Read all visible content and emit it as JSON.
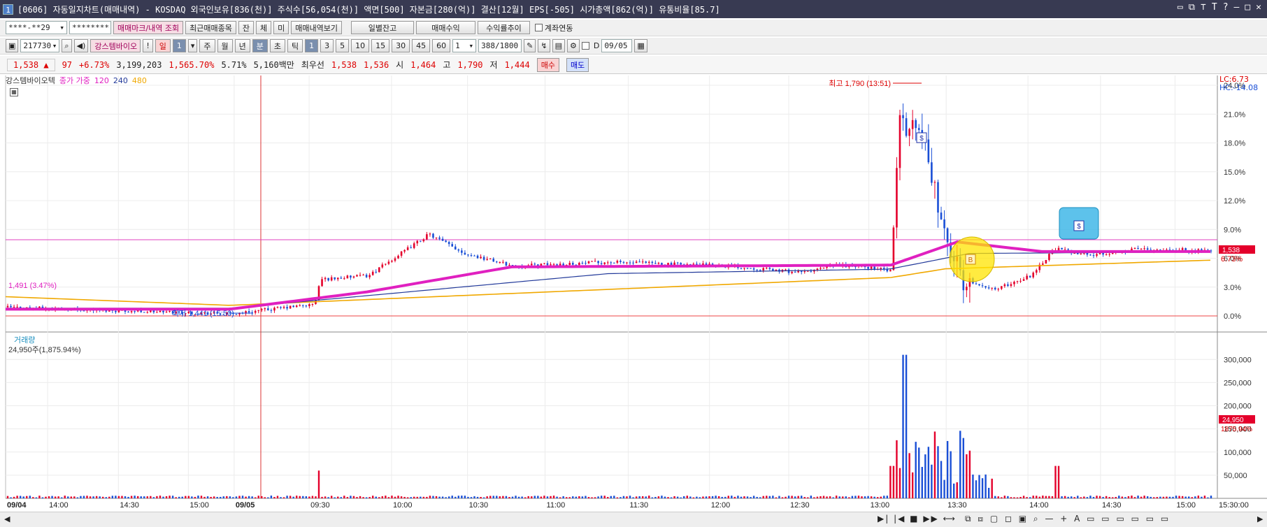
{
  "title": {
    "num": "1",
    "text": "[0606] 자동일지차트(매매내역) - KOSDAQ 외국인보유[836(천)] 주식수[56,054(천)] 액면[500] 자본금[280(억)] 결산[12월] EPS[-505] 시가총액[862(억)] 유통비율[85.7]"
  },
  "toolbar1": {
    "account": "****-**29",
    "password": "********",
    "btn1": "매매마크/내역 조회",
    "btn2": "최근매매종목",
    "btn3": "잔",
    "btn4": "체",
    "btn5": "미",
    "btn6": "매매내역보기",
    "btn7": "일별잔고",
    "btn8": "매매수익",
    "btn9": "수익률추이",
    "check": "계좌연동"
  },
  "toolbar2": {
    "code": "217730",
    "stock": "강스템바이오",
    "periods": [
      "일",
      "1",
      "주",
      "월",
      "년",
      "분",
      "초",
      "틱"
    ],
    "nums": [
      "1",
      "3",
      "5",
      "10",
      "15",
      "30",
      "45",
      "60"
    ],
    "count": "1",
    "range": "388/1800",
    "d": "D",
    "date": "09/05"
  },
  "quote": {
    "price": "1,538 ▲",
    "chg": "97",
    "pct": "+6.73%",
    "vol": "3,199,203",
    "volpct": "1,565.70%",
    "turn": "5.71%",
    "amt": "5,160백만",
    "best_label": "최우선",
    "best1": "1,538",
    "best2": "1,536",
    "open_l": "시",
    "open": "1,464",
    "high_l": "고",
    "high": "1,790",
    "low_l": "저",
    "low": "1,444",
    "buy": "매수",
    "sell": "매도"
  },
  "chart_data": {
    "type": "candlestick",
    "legend": {
      "name": "강스템바이오텍",
      "ma_label": "종가 가중",
      "ma1": "120",
      "ma2": "240",
      "ma3": "480"
    },
    "volume_label": "거래량",
    "volume_value": "24,950주(1,875.94%)",
    "lc": "LC:6.73",
    "hc": "HC:-14.08",
    "high_ann": "최고 1,790 (13:51)",
    "low_ann": "최저 1,441 (15:50)",
    "hline_label": "1,491 (3.47%)",
    "price_tag": "1,538",
    "pct_tag": "6.73%",
    "vol_tag": "24,950",
    "volpct_tag": "1875.94%",
    "y_ticks": [
      "24.0%",
      "21.0%",
      "18.0%",
      "15.0%",
      "12.0%",
      "9.0%",
      "6.0%",
      "3.0%",
      "0.0%"
    ],
    "vol_ticks": [
      "300,000",
      "250,000",
      "200,000",
      "150,000",
      "100,000",
      "50,000"
    ],
    "x_labels": [
      "09/04",
      "14:00",
      "14:30",
      "15:00",
      "09/05",
      "09:30",
      "10:00",
      "10:30",
      "11:00",
      "11:30",
      "12:00",
      "12:30",
      "13:00",
      "13:30",
      "14:00",
      "14:30",
      "15:00",
      "15:30:00"
    ],
    "ylim": [
      0,
      24
    ],
    "volume_max": 320000,
    "colors": {
      "up": "#e4002b",
      "down": "#1a4fd6",
      "ma1": "#e020c0",
      "ma2": "#233a9a",
      "ma3": "#f0a800"
    }
  }
}
